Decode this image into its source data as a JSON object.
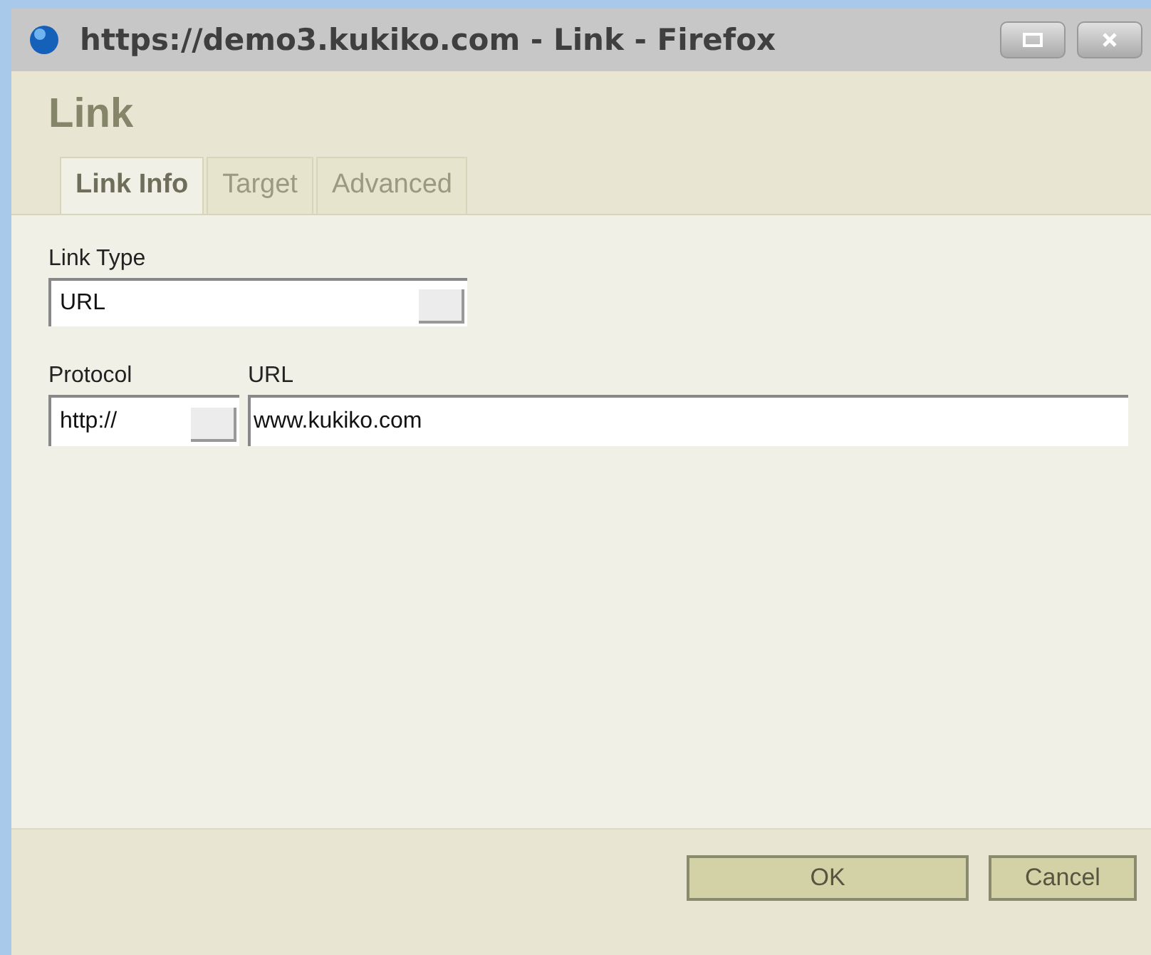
{
  "window": {
    "title": "https://demo3.kukiko.com - Link - Firefox"
  },
  "dialog": {
    "title": "Link"
  },
  "tabs": [
    {
      "label": "Link Info",
      "selected": true
    },
    {
      "label": "Target",
      "selected": false
    },
    {
      "label": "Advanced",
      "selected": false
    }
  ],
  "link_type": {
    "label": "Link Type",
    "value": "URL"
  },
  "protocol": {
    "label": "Protocol",
    "value": "http://"
  },
  "url": {
    "label": "URL",
    "value": "www.kukiko.com"
  },
  "buttons": [
    {
      "label": "OK",
      "kind": "ok"
    },
    {
      "label": "Cancel",
      "kind": "cancel"
    }
  ]
}
